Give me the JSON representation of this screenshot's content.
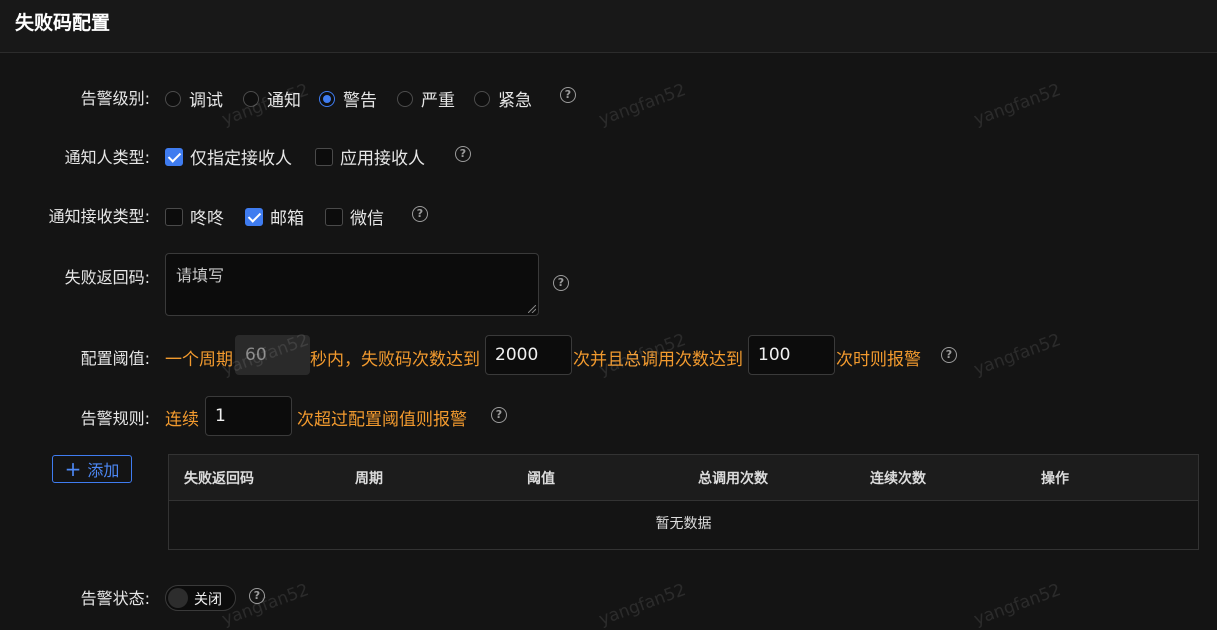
{
  "header": {
    "title": "失败码配置"
  },
  "form": {
    "alarm_level": {
      "label": "告警级别:",
      "options": [
        {
          "label": "调试",
          "selected": false
        },
        {
          "label": "通知",
          "selected": false
        },
        {
          "label": "警告",
          "selected": true
        },
        {
          "label": "严重",
          "selected": false
        },
        {
          "label": "紧急",
          "selected": false
        }
      ]
    },
    "notifier_type": {
      "label": "通知人类型:",
      "options": [
        {
          "label": "仅指定接收人",
          "checked": true
        },
        {
          "label": "应用接收人",
          "checked": false
        }
      ]
    },
    "notify_channel": {
      "label": "通知接收类型:",
      "options": [
        {
          "label": "咚咚",
          "checked": false
        },
        {
          "label": "邮箱",
          "checked": true
        },
        {
          "label": "微信",
          "checked": false
        }
      ]
    },
    "fail_codes": {
      "label": "失败返回码:",
      "placeholder": "请填写"
    },
    "threshold": {
      "label": "配置阈值:",
      "text_1": "一个周期",
      "period": "60",
      "text_2": "秒内，失败码次数达到",
      "fail_count": "2000",
      "text_3": "次并且总调用次数达到",
      "total_count": "100",
      "text_4": "次时则报警"
    },
    "rule": {
      "label": "告警规则:",
      "text_1": "连续",
      "consecutive": "1",
      "text_2": "次超过配置阈值则报警"
    },
    "add_button": "添加",
    "table": {
      "columns": [
        "失败返回码",
        "周期",
        "阈值",
        "总调用次数",
        "连续次数",
        "操作"
      ],
      "rows": [],
      "empty_text": "暂无数据"
    },
    "status": {
      "label": "告警状态:",
      "switch_text": "关闭",
      "on": false
    }
  },
  "watermark": "yangfan52",
  "colors": {
    "accent": "#3f7cf0",
    "highlight_text": "#f29a2e",
    "background": "#141414"
  }
}
